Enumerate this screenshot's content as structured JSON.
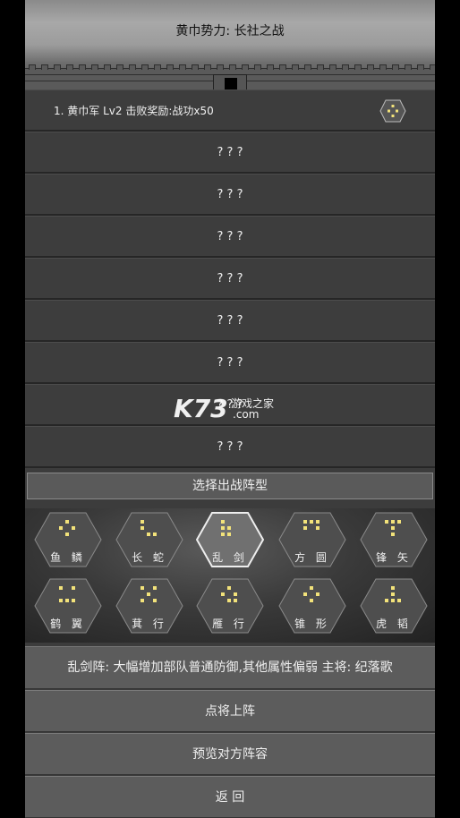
{
  "header": {
    "title": "黄巾势力: 长社之战"
  },
  "list": {
    "first": {
      "text": "1.  黄巾军  Lv2  击败奖励:战功x50"
    },
    "unknown_rows": [
      "? ? ?",
      "? ? ?",
      "? ? ?",
      "? ? ?",
      "? ? ?",
      "? ? ?",
      "? ? ?",
      "? ? ?"
    ]
  },
  "watermark": {
    "logo": "K73",
    "text": "游戏之家",
    "domain": ".com"
  },
  "select_bar": {
    "label": "选择出战阵型"
  },
  "formations": [
    {
      "label": "鱼 鳞",
      "selected": false
    },
    {
      "label": "长 蛇",
      "selected": false
    },
    {
      "label": "乱 剑",
      "selected": true
    },
    {
      "label": "方 圆",
      "selected": false
    },
    {
      "label": "锋 矢",
      "selected": false
    },
    {
      "label": "鹤 翼",
      "selected": false
    },
    {
      "label": "萁 行",
      "selected": false
    },
    {
      "label": "雁 行",
      "selected": false
    },
    {
      "label": "锥 形",
      "selected": false
    },
    {
      "label": "虎 韬",
      "selected": false
    }
  ],
  "description": {
    "text": "乱剑阵: 大幅增加部队普通防御,其他属性偏弱    主将: 纪落歌"
  },
  "buttons": {
    "deploy": "点将上阵",
    "preview": "预览对方阵容",
    "back": "返        回"
  },
  "colors": {
    "panel": "#3c3c3c",
    "row_divider": "#262626",
    "button": "#5c5c5c",
    "dot": "#f2e27a"
  }
}
